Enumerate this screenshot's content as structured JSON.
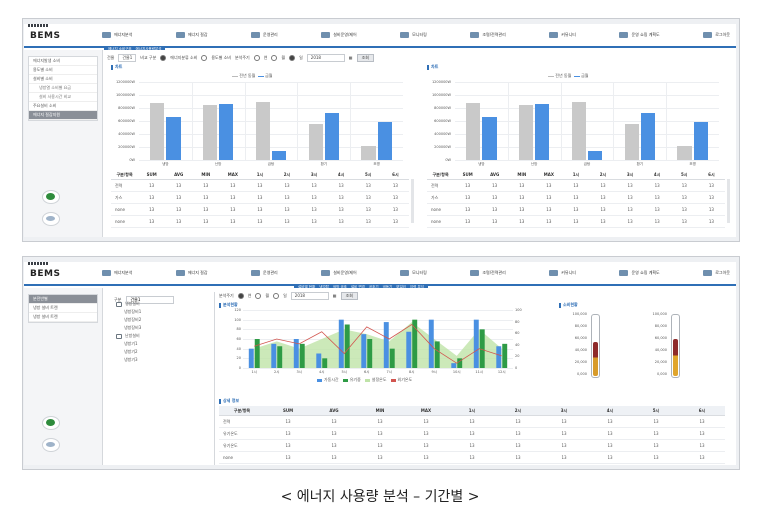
{
  "app_title": "BEMS",
  "caption": "< 에너지 사용량 분석 – 기간별 >",
  "colors": {
    "header_blue": "#2f6fb6",
    "bar_gray": "#c9c9c9",
    "bar_blue": "#4a90e2",
    "bar_green": "#2e9b45",
    "line_red": "#d2554f",
    "area_green": "#bfe3a8"
  },
  "top": {
    "nav": [
      "에너지분석",
      "에너지 절감",
      "운영관리",
      "설비운영/제어",
      "모니터링",
      "조명/전력관리",
      "커뮤니티",
      "운영 쇼핑 계획도",
      "로그아웃"
    ],
    "subnav": [
      "에너지 소비구조",
      "에너지사용량분석"
    ],
    "sidebar": [
      "에너지발생 소비",
      "용도별 소비",
      "설비별 소비",
      "냉방열 소비별 요금",
      "설비 사용시간 비교",
      "주요설비 소비",
      "에너지 절감지원"
    ],
    "filter": {
      "label1": "건물",
      "building": "건물1",
      "label2": "비교 구분",
      "r1": "에너지분류 소비",
      "r2": "용도별 소비",
      "label3": "분석주기",
      "r3": "연",
      "r4": "월",
      "r5": "일",
      "date": "2018",
      "search": "조회"
    },
    "panel_title": "차트",
    "legend": [
      "전년 동월",
      "금월"
    ],
    "y_ticks": [
      "1200000W",
      "1000000W",
      "800000W",
      "600000W",
      "400000W",
      "200000W",
      "0W"
    ],
    "x_labels": [
      "냉방",
      "난방",
      "급탕",
      "환기",
      "조명"
    ],
    "table_headers": [
      "구분/항목",
      "SUM",
      "AVG",
      "MIN",
      "MAX",
      "1시",
      "2시",
      "3시",
      "4시",
      "5시",
      "6시"
    ],
    "table_rows": [
      [
        "전력",
        "13",
        "13",
        "13",
        "13",
        "13",
        "13",
        "13",
        "13",
        "13",
        "13"
      ],
      [
        "가스",
        "13",
        "13",
        "13",
        "13",
        "13",
        "13",
        "13",
        "13",
        "13",
        "13"
      ],
      [
        "none",
        "13",
        "13",
        "13",
        "13",
        "13",
        "13",
        "13",
        "13",
        "13",
        "13"
      ],
      [
        "none",
        "13",
        "13",
        "13",
        "13",
        "13",
        "13",
        "13",
        "13",
        "13",
        "13"
      ]
    ]
  },
  "bottom": {
    "nav": [
      "에너지분석",
      "에너지 절감",
      "운영관리",
      "설비운영/제어",
      "모니터링",
      "조명/전력관리",
      "커뮤니티",
      "운영 쇼핑 계획도",
      "로그아웃"
    ],
    "subnav": [
      "설비별 현황",
      "냉각탑",
      "냉방 공조",
      "설비 변경",
      "공조기",
      "냉동기",
      "보일러",
      "이력 분석"
    ],
    "sidebar": [
      "분전반별",
      "냉방 설비 트렌",
      "냉방 설비 트렌"
    ],
    "tree_select": "건물1",
    "tree": [
      "냉방설비",
      "냉방장비1",
      "냉방장비2",
      "냉방장비3",
      "난방설비",
      "냉방기1",
      "냉방기2",
      "냉방기3"
    ],
    "filter": {
      "label": "분석주기",
      "r1": "연",
      "r2": "월",
      "r3": "일",
      "date": "2018",
      "search": "조회"
    },
    "panel1_title": "분석현황",
    "panel2_title": "소비현황",
    "panel3_title": "상세 정보",
    "y_ticks_left": [
      "120",
      "100",
      "80",
      "60",
      "40",
      "20",
      "0"
    ],
    "y_ticks_right": [
      "100",
      "80",
      "60",
      "40",
      "20",
      "0"
    ],
    "x_labels": [
      "1시",
      "2시",
      "3시",
      "4시",
      "5시",
      "6시",
      "7시",
      "8시",
      "9시",
      "10시",
      "11시",
      "12시"
    ],
    "legend": [
      "가동시간",
      "유기중",
      "설정온도",
      "외기온도"
    ],
    "therm_ticks": [
      "100,000",
      "80,000",
      "60,000",
      "40,000",
      "20,000",
      "0,000"
    ],
    "table_headers": [
      "구분/항목",
      "SUM",
      "AVG",
      "MIN",
      "MAX",
      "1시",
      "2시",
      "3시",
      "4시",
      "5시",
      "6시"
    ],
    "table_rows": [
      [
        "전력",
        "13",
        "13",
        "13",
        "13",
        "13",
        "13",
        "13",
        "13",
        "13",
        "13"
      ],
      [
        "유기온도",
        "13",
        "13",
        "13",
        "13",
        "13",
        "13",
        "13",
        "13",
        "13",
        "13"
      ],
      [
        "유기온도",
        "13",
        "13",
        "13",
        "13",
        "13",
        "13",
        "13",
        "13",
        "13",
        "13"
      ],
      [
        "none",
        "13",
        "13",
        "13",
        "13",
        "13",
        "13",
        "13",
        "13",
        "13",
        "13"
      ]
    ]
  },
  "chart_data": [
    {
      "type": "bar",
      "categories": [
        "냉방",
        "난방",
        "급탕",
        "환기",
        "조명"
      ],
      "series": [
        {
          "name": "전년 동월",
          "values": [
            870000,
            840000,
            900000,
            560000,
            220000
          ]
        },
        {
          "name": "금월",
          "values": [
            660000,
            860000,
            140000,
            730000,
            590000
          ]
        }
      ],
      "ylim": [
        0,
        1200000
      ]
    },
    {
      "type": "bar",
      "categories": [
        "냉방",
        "난방",
        "급탕",
        "환기",
        "조명"
      ],
      "series": [
        {
          "name": "전년 동월",
          "values": [
            870000,
            840000,
            900000,
            560000,
            220000
          ]
        },
        {
          "name": "금월",
          "values": [
            660000,
            860000,
            140000,
            730000,
            590000
          ]
        }
      ],
      "ylim": [
        0,
        1200000
      ]
    },
    {
      "type": "bar",
      "categories": [
        "1시",
        "2시",
        "3시",
        "4시",
        "5시",
        "6시",
        "7시",
        "8시",
        "9시",
        "10시",
        "11시",
        "12시"
      ],
      "series": [
        {
          "name": "가동시간",
          "values": [
            40,
            50,
            60,
            30,
            100,
            70,
            95,
            75,
            100,
            10,
            100,
            45
          ]
        },
        {
          "name": "유기중",
          "values": [
            60,
            45,
            50,
            20,
            90,
            60,
            40,
            100,
            55,
            20,
            80,
            50
          ]
        },
        {
          "name": "설정온도",
          "values": [
            40,
            55,
            40,
            60,
            80,
            70,
            55,
            95,
            60,
            25,
            80,
            40
          ]
        },
        {
          "name": "외기온도",
          "values": [
            45,
            60,
            50,
            75,
            30,
            85,
            60,
            90,
            40,
            10,
            40,
            25
          ]
        }
      ],
      "ylim": [
        0,
        120
      ]
    }
  ]
}
